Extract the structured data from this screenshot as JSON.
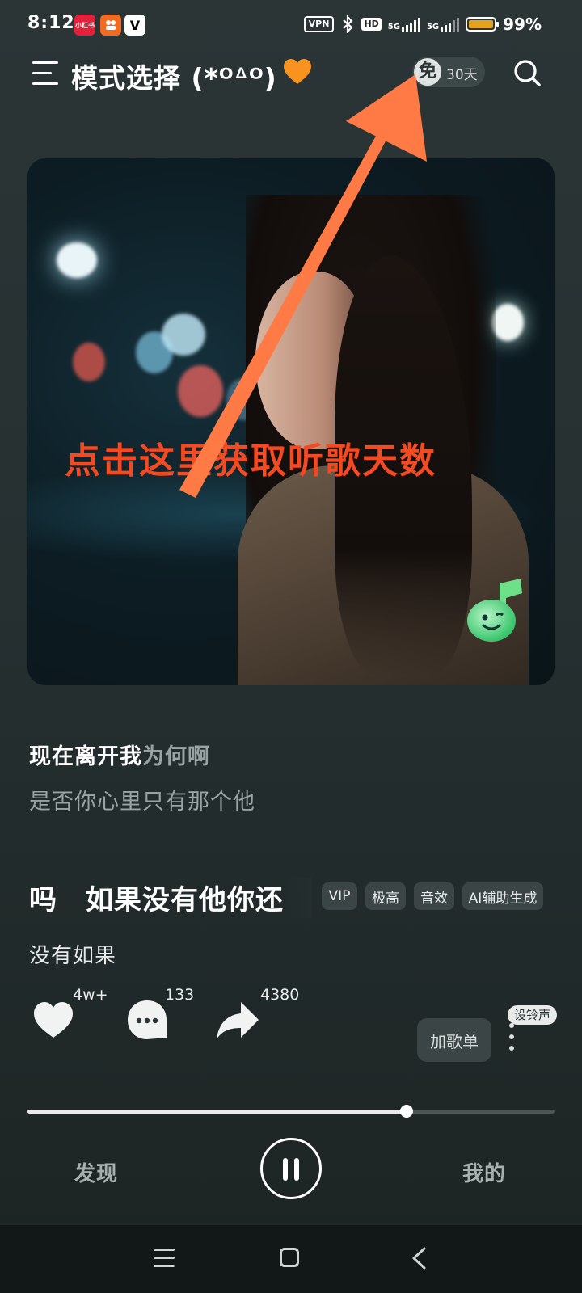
{
  "status_bar": {
    "time": "8:12",
    "app_badges": [
      {
        "label": "小红书",
        "color": "#e6203a"
      },
      {
        "label": "",
        "color": "#f26b1f"
      },
      {
        "label": "V",
        "color": "#ffffff"
      }
    ],
    "vpn": "VPN",
    "hd": "HD",
    "net1": "5G",
    "net2": "5G",
    "battery_level": 0.99,
    "battery_text": "99%"
  },
  "header": {
    "title": "模式选择 (*ᴼᐞᴼ)",
    "title_emoji_icon": "orange-heart-icon",
    "free_char": "免",
    "free_days": "30天"
  },
  "cover": {
    "mascot_icon": "music-note-mascot-icon"
  },
  "annotation": {
    "text": "点击这里获取听歌天数",
    "color": "#f34a22"
  },
  "lyrics": {
    "line1_sung": "现在离开我",
    "line1_unsung": "为何啊",
    "line2": "是否你心里只有那个他"
  },
  "song": {
    "title_scroll": "吗　如果没有他你还",
    "tags": [
      "VIP",
      "极高",
      "音效",
      "AI辅助生成"
    ],
    "artist": "没有如果"
  },
  "actions": {
    "likes": "4w+",
    "comments": "133",
    "shares": "4380",
    "add_playlist": "加歌单",
    "ringtone": "设铃声"
  },
  "player": {
    "progress": 0.72
  },
  "nav": {
    "discover": "发现",
    "mine": "我的"
  },
  "colors": {
    "accent_arrow": "#ff7a45",
    "battery": "#e5a21c"
  }
}
